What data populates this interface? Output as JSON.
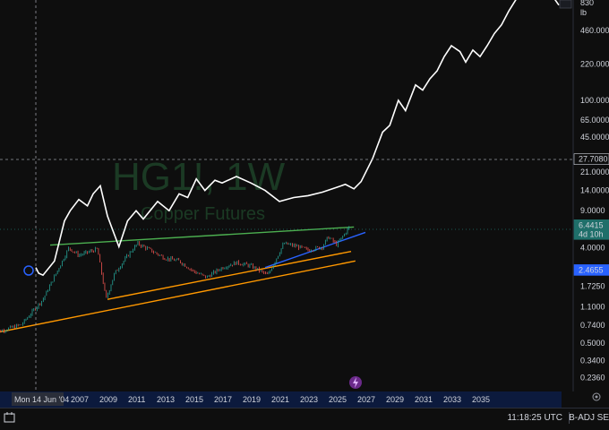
{
  "watermark": {
    "symbol": "HG1!, 1W",
    "name": "Copper Futures"
  },
  "price_axis": {
    "unit": "lb",
    "top_label": "830",
    "ticks": [
      "460.0000",
      "220.0000",
      "100.0000",
      "65.0000",
      "45.0000",
      "21.0000",
      "14.0000",
      "9.0000",
      "4.0000",
      "1.7250",
      "1.1000",
      "0.7400",
      "0.5000",
      "0.3400",
      "0.2360"
    ],
    "labels": [
      {
        "value": "27.7080",
        "bg": "#0e0e0e",
        "fg": "#ffffff"
      },
      {
        "value": "6.4415",
        "sub": "4d 10h",
        "bg": "#1f6f6a",
        "fg": "#ffffff"
      },
      {
        "value": "2.4655",
        "bg": "#2962ff",
        "fg": "#ffffff"
      }
    ]
  },
  "time_axis": {
    "cursor_label": "Mon 14 Jun '04",
    "years": [
      "2007",
      "2009",
      "2011",
      "2013",
      "2015",
      "2017",
      "2019",
      "2021",
      "2023",
      "2025",
      "2027",
      "2029",
      "2031",
      "2033",
      "2035"
    ]
  },
  "status_bar": {
    "clock": "11:18:25 UTC",
    "adjustment": "B-ADJ",
    "session": "SE"
  },
  "chart_data": {
    "type": "line",
    "log_scale": true,
    "grid": false,
    "colors": {
      "candles_up": "#26a69a",
      "candles_down": "#ef5350",
      "projection": "#ffffff",
      "resistance": "#4caf50",
      "support": "#ff9800",
      "channel": "#2962ff"
    },
    "series": [
      {
        "kind": "price",
        "x": [
          2001.0,
          2003.0,
          2004.5,
          2006.0,
          2006.3,
          2007.0,
          2008.3,
          2008.9,
          2009.5,
          2010.5,
          2011.1,
          2012.0,
          2013.0,
          2014.0,
          2015.0,
          2015.9,
          2017.0,
          2018.0,
          2019.0,
          2020.2,
          2021.3,
          2022.3,
          2023.0,
          2024.0,
          2024.4,
          2025.0,
          2025.5,
          2025.9
        ],
        "values": [
          0.62,
          0.75,
          1.3,
          3.3,
          4.0,
          3.4,
          3.9,
          1.3,
          2.3,
          3.5,
          4.4,
          3.8,
          3.2,
          3.0,
          2.4,
          2.1,
          2.6,
          2.9,
          2.7,
          2.2,
          4.4,
          4.1,
          3.8,
          4.1,
          5.1,
          4.3,
          5.3,
          6.44
        ]
      },
      {
        "kind": "projection",
        "x": [
          2004.0,
          2004.2,
          2004.5,
          2005.3,
          2006.0,
          2006.4,
          2007.0,
          2007.6,
          2008.0,
          2008.5,
          2009.0,
          2009.8,
          2010.4,
          2011.0,
          2011.5,
          2012.5,
          2013.3,
          2014.0,
          2014.6,
          2015.2,
          2015.8,
          2016.5,
          2017.0,
          2018.0,
          2019.0,
          2020.0,
          2021.0,
          2022.0,
          2023.0,
          2024.0,
          2025.0,
          2025.6,
          2026.2,
          2026.7,
          2027.5,
          2028.2,
          2028.7,
          2029.3,
          2029.8,
          2030.5,
          2031.0,
          2031.5,
          2032.0,
          2032.5,
          2033.0,
          2033.6,
          2034.0,
          2034.5,
          2035.0,
          2035.5,
          2036.0,
          2036.5,
          2037.0,
          2037.5,
          2038.0,
          2038.5,
          2039.0,
          2039.5,
          2040.0,
          2040.5
        ],
        "values": [
          2.6,
          2.3,
          2.2,
          3.0,
          7.2,
          9.0,
          11.5,
          10.0,
          13.0,
          15.5,
          8.0,
          4.1,
          7.2,
          9.0,
          7.5,
          11.0,
          9.0,
          13.0,
          12.0,
          18.0,
          14.0,
          17.5,
          16.5,
          19.0,
          16.5,
          14.0,
          11.0,
          12.0,
          12.5,
          13.5,
          15.0,
          16.0,
          14.5,
          17.0,
          28.0,
          50.0,
          58.0,
          100.0,
          80.0,
          140.0,
          125.0,
          160.0,
          190.0,
          260.0,
          330.0,
          290.0,
          230.0,
          300.0,
          260.0,
          330.0,
          430.0,
          520.0,
          700.0,
          900.0,
          1100.0,
          1050.0,
          1400.0,
          1150.0,
          1000.0,
          800.0
        ]
      }
    ],
    "trendlines": [
      {
        "name": "",
        "color": "#4caf50",
        "x": [
          2005.0,
          2026.2
        ],
        "values": [
          4.25,
          6.3
        ]
      },
      {
        "name": "",
        "color": "#ff9800",
        "x": [
          2009.0,
          2026.0
        ],
        "values": [
          1.3,
          3.7
        ]
      },
      {
        "name": "",
        "color": "#ff9800",
        "x": [
          2000.5,
          2026.3
        ],
        "values": [
          0.6,
          3.0
        ]
      },
      {
        "name": "",
        "color": "#2962ff",
        "x": [
          2020.0,
          2027.0
        ],
        "values": [
          2.6,
          5.6
        ]
      }
    ],
    "xlim": [
      2004.0,
      2040.5
    ],
    "ylim": [
      0.2,
      830
    ]
  }
}
